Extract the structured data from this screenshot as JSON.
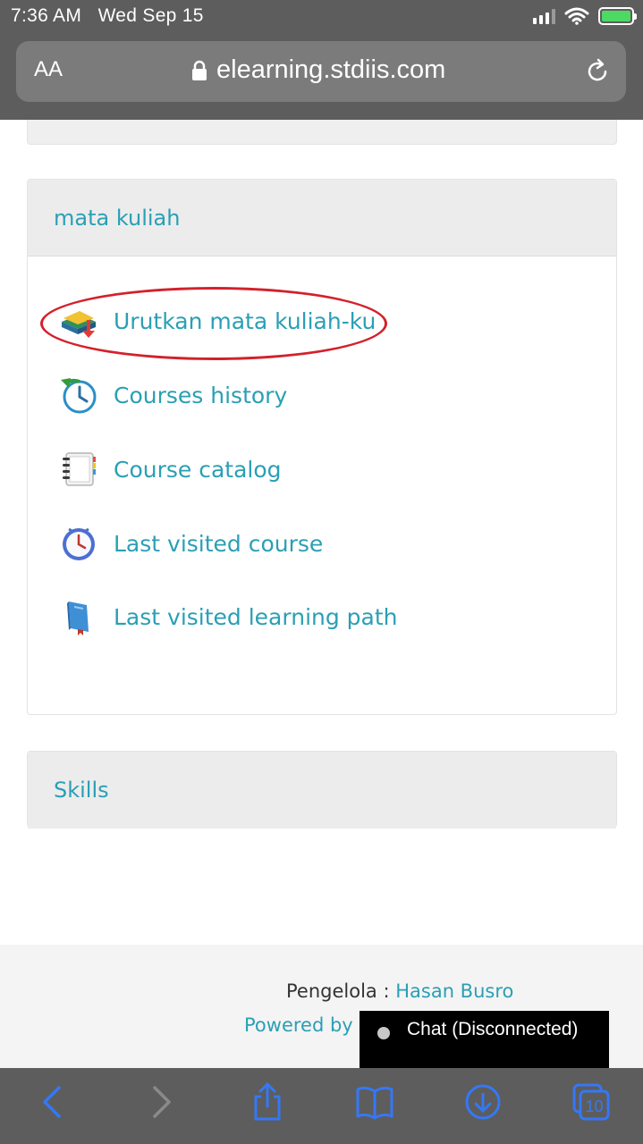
{
  "status_bar": {
    "time": "7:36 AM",
    "date": "Wed Sep 15"
  },
  "url_bar": {
    "text_size_label": "AA",
    "domain": "elearning.stdiis.com"
  },
  "courses_block": {
    "title": "mata kuliah",
    "items": [
      {
        "label": "Urutkan mata kuliah-ku",
        "icon": "sort-courses-icon"
      },
      {
        "label": "Courses history",
        "icon": "history-clock-icon"
      },
      {
        "label": "Course catalog",
        "icon": "catalog-notebook-icon"
      },
      {
        "label": "Last visited course",
        "icon": "clock-icon"
      },
      {
        "label": "Last visited learning path",
        "icon": "book-icon"
      }
    ]
  },
  "skills_block": {
    "title": "Skills"
  },
  "footer": {
    "manager_label": "Pengelola :",
    "manager_name": "Hasan Busro",
    "powered_by": "Powered by C"
  },
  "chat": {
    "label": "Chat (Disconnected)"
  },
  "toolbar": {
    "tabs_count": "10"
  },
  "colors": {
    "link": "#2a9fb5",
    "browser_chrome": "#5d5d5d",
    "toolbar_icon": "#3478f6",
    "highlight": "#d3212b"
  }
}
